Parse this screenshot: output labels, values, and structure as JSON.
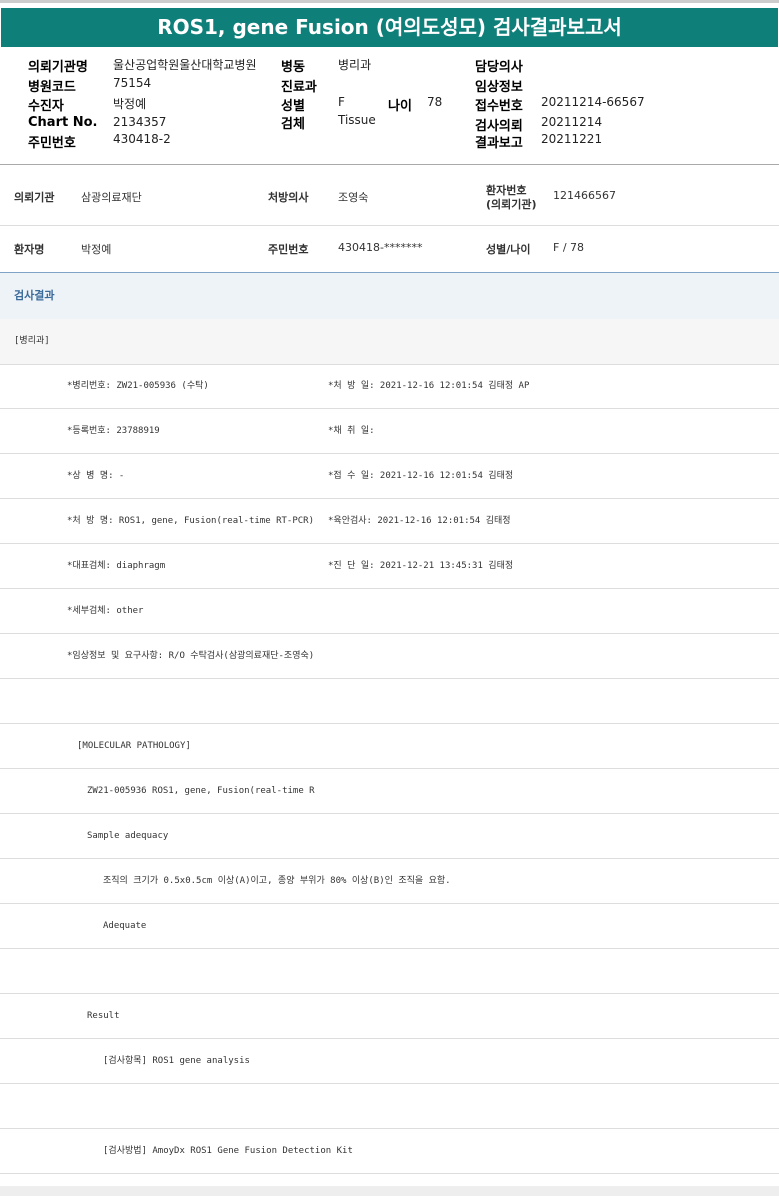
{
  "title": "ROS1, gene Fusion (여의도성모) 검사결과보고서",
  "header": {
    "inst_label": "의뢰기관명",
    "inst": "울산공업학원울산대학교병원",
    "code_label": "병원코드",
    "code": "75154",
    "patient_label": "수진자",
    "patient": "박정예",
    "chart_label": "Chart No.",
    "chart": "2134357",
    "rrn_label": "주민번호",
    "rrn": "430418-2",
    "ward_label": "병동",
    "ward": "병리과",
    "dept_label": "진료과",
    "sex_label": "성별",
    "sex": "F",
    "age_label": "나이",
    "age": "78",
    "specimen_label": "검체",
    "specimen": "Tissue",
    "doctor_label": "담당의사",
    "clinical_label": "임상정보",
    "receipt_label": "접수번호",
    "receipt": "20211214-66567",
    "request_label": "검사의뢰",
    "request": "20211214",
    "report_label": "결과보고",
    "report": "20211221"
  },
  "patient": {
    "inst_label": "의뢰기관",
    "inst": "삼광의료재단",
    "doctor_label": "처방의사",
    "doctor": "조영숙",
    "pid_label": "환자번호",
    "pid_label2": "(의뢰기관)",
    "pid": "121466567",
    "name_label": "환자명",
    "name": "박정예",
    "rrn_label": "주민번호",
    "rrn": "430418-*******",
    "sexage_label": "성별/나이",
    "sexage": "F / 78"
  },
  "section": "검사결과",
  "dept": "[병리과]",
  "rows": [
    {
      "l": "*병리번호: ZW21-005936 (수탁)",
      "r": "*처 방 일: 2021-12-16 12:01:54  김태정 AP"
    },
    {
      "l": "*등록번호: 23788919",
      "r": "*채 취 일:"
    },
    {
      "l": "*상 병 명: -",
      "r": "*접 수 일: 2021-12-16 12:01:54  김태정"
    },
    {
      "l": "*처 방 명: ROS1, gene, Fusion(real-time RT-PCR)",
      "r": "*육안검사: 2021-12-16 12:01:54  김태정"
    },
    {
      "l": "*대표검체: diaphragm",
      "r": "*진 단 일: 2021-12-21 13:45:31  김태정"
    },
    {
      "l": "*세부검체: other",
      "r": ""
    },
    {
      "l": "*임상정보 및 요구사항: R/O 수탁검사(삼광의료재단-조영숙)",
      "r": ""
    }
  ],
  "report_lines": [
    "",
    "[MOLECULAR PATHOLOGY]",
    "ZW21-005936     ROS1, gene, Fusion(real-time R",
    "Sample adequacy",
    "조직의 크기가 0.5x0.5cm 이상(A)이고, 종양 부위가 80% 이상(B)인 조직을 요함.",
    "Adequate",
    "",
    "Result",
    "[검사항목] ROS1 gene analysis",
    "",
    "[검사방법] AmoyDx ROS1 Gene Fusion Detection Kit"
  ]
}
